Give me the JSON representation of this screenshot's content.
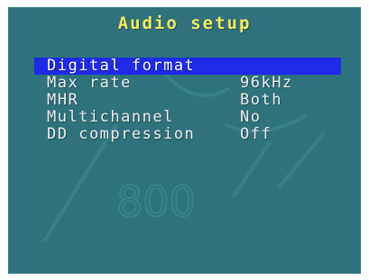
{
  "screen": {
    "title": "Audio setup",
    "background_color": "#2f727d",
    "title_color": "#f4ea5e",
    "highlight_color": "#1f2ae8"
  },
  "menu": {
    "items": [
      {
        "label": "Digital format",
        "value": "",
        "selected": true
      },
      {
        "label": "Max rate",
        "value": "96kHz",
        "selected": false
      },
      {
        "label": "MHR",
        "value": "Both",
        "selected": false
      },
      {
        "label": "Multichannel",
        "value": "No",
        "selected": false
      },
      {
        "label": "DD compression",
        "value": "Off",
        "selected": false
      }
    ]
  },
  "watermark": {
    "text": "800"
  }
}
